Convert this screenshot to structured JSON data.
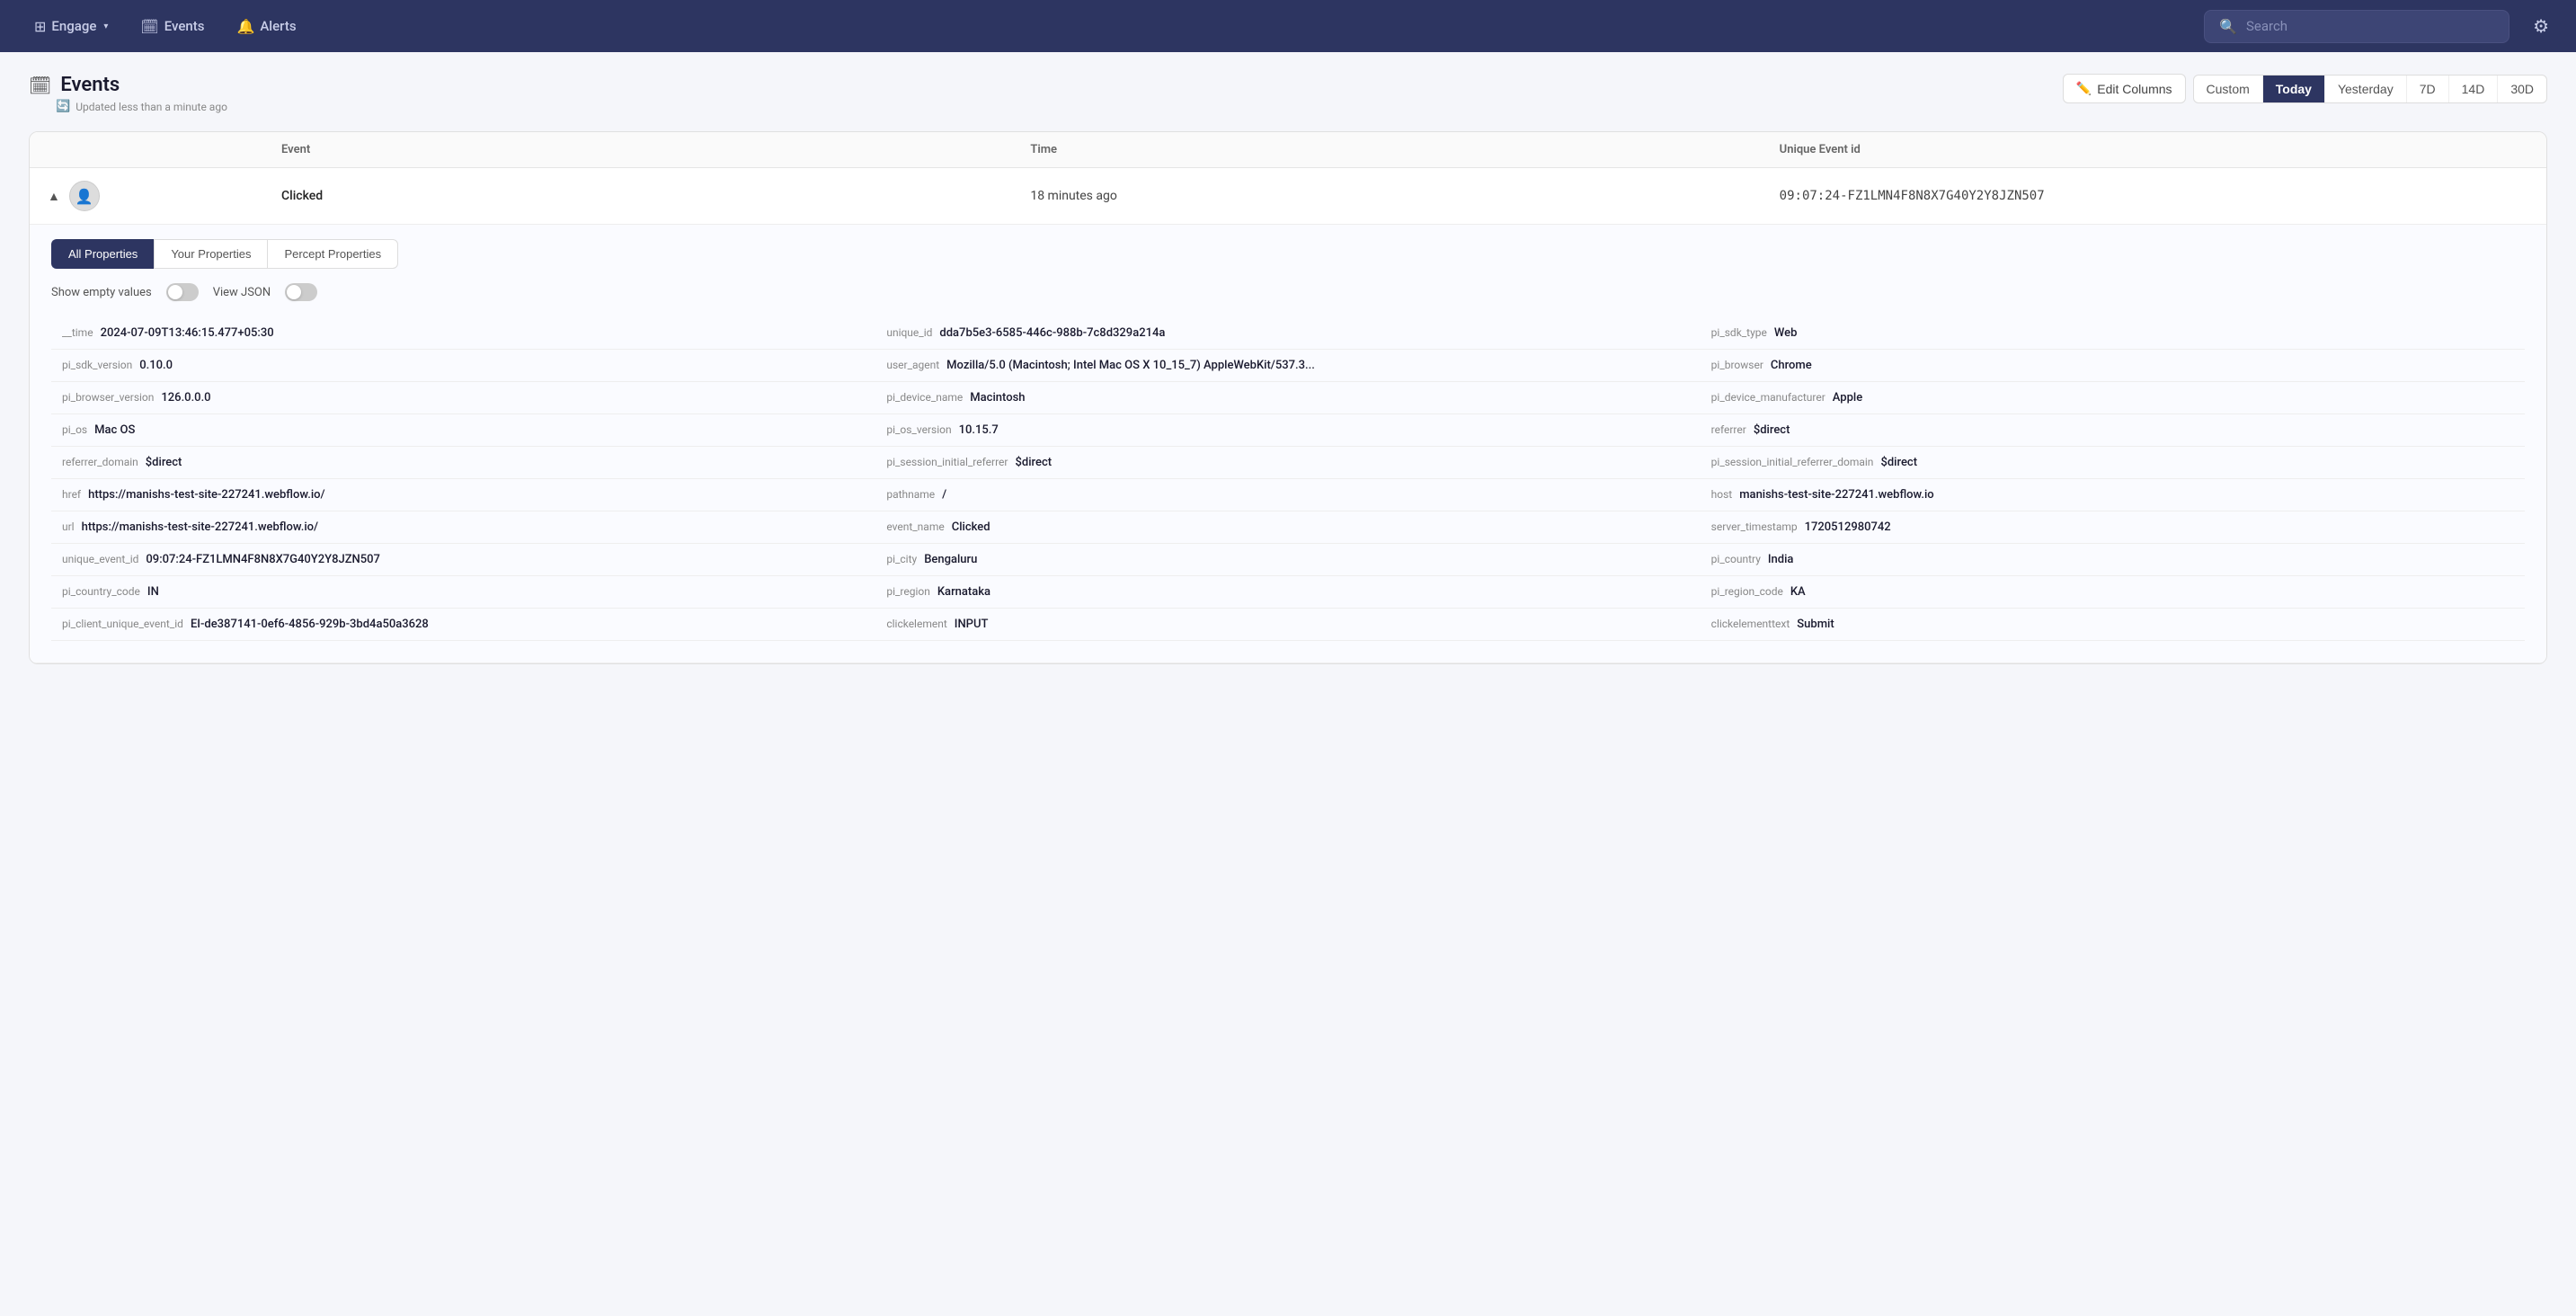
{
  "topnav": {
    "engage_label": "Engage",
    "events_label": "Events",
    "alerts_label": "Alerts",
    "search_placeholder": "Search"
  },
  "page": {
    "title": "Events",
    "title_icon": "📅",
    "updated_text": "Updated less than a minute ago",
    "edit_columns_label": "Edit Columns"
  },
  "time_filters": [
    {
      "label": "Custom",
      "key": "custom",
      "active": false
    },
    {
      "label": "Today",
      "key": "today",
      "active": true
    },
    {
      "label": "Yesterday",
      "key": "yesterday",
      "active": false
    },
    {
      "label": "7D",
      "key": "7d",
      "active": false
    },
    {
      "label": "14D",
      "key": "14d",
      "active": false
    },
    {
      "label": "30D",
      "key": "30d",
      "active": false
    }
  ],
  "table": {
    "columns": [
      "",
      "Event",
      "Time",
      "Unique Event id"
    ],
    "rows": [
      {
        "event": "Clicked",
        "time": "18 minutes ago",
        "unique_event_id": "09:07:24-FZ1LMN4F8N8X7G40Y2Y8JZN507",
        "expanded": true
      }
    ]
  },
  "property_tabs": [
    {
      "label": "All Properties",
      "active": true
    },
    {
      "label": "Your Properties",
      "active": false
    },
    {
      "label": "Percept Properties",
      "active": false
    }
  ],
  "toggles": {
    "show_empty_label": "Show empty values",
    "view_json_label": "View JSON"
  },
  "properties": [
    {
      "key": "__time",
      "value": "2024-07-09T13:46:15.477+05:30"
    },
    {
      "key": "unique_id",
      "value": "dda7b5e3-6585-446c-988b-7c8d329a214a"
    },
    {
      "key": "pi_sdk_type",
      "value": "Web"
    },
    {
      "key": "pi_sdk_version",
      "value": "0.10.0"
    },
    {
      "key": "user_agent",
      "value": "Mozilla/5.0 (Macintosh; Intel Mac OS X 10_15_7) AppleWebKit/537.3..."
    },
    {
      "key": "pi_browser",
      "value": "Chrome"
    },
    {
      "key": "pi_browser_version",
      "value": "126.0.0.0"
    },
    {
      "key": "pi_device_name",
      "value": "Macintosh"
    },
    {
      "key": "pi_device_manufacturer",
      "value": "Apple"
    },
    {
      "key": "pi_os",
      "value": "Mac OS"
    },
    {
      "key": "pi_os_version",
      "value": "10.15.7"
    },
    {
      "key": "referrer",
      "value": "$direct"
    },
    {
      "key": "referrer_domain",
      "value": "$direct"
    },
    {
      "key": "pi_session_initial_referrer",
      "value": "$direct"
    },
    {
      "key": "pi_session_initial_referrer_domain",
      "value": "$direct"
    },
    {
      "key": "href",
      "value": "https://manishs-test-site-227241.webflow.io/"
    },
    {
      "key": "pathname",
      "value": "/"
    },
    {
      "key": "host",
      "value": "manishs-test-site-227241.webflow.io"
    },
    {
      "key": "url",
      "value": "https://manishs-test-site-227241.webflow.io/"
    },
    {
      "key": "event_name",
      "value": "Clicked"
    },
    {
      "key": "server_timestamp",
      "value": "1720512980742"
    },
    {
      "key": "unique_event_id",
      "value": "09:07:24-FZ1LMN4F8N8X7G40Y2Y8JZN507"
    },
    {
      "key": "pi_city",
      "value": "Bengaluru"
    },
    {
      "key": "pi_country",
      "value": "India"
    },
    {
      "key": "pi_country_code",
      "value": "IN"
    },
    {
      "key": "pi_region",
      "value": "Karnataka"
    },
    {
      "key": "pi_region_code",
      "value": "KA"
    },
    {
      "key": "pi_client_unique_event_id",
      "value": "EI-de387141-0ef6-4856-929b-3bd4a50a3628"
    },
    {
      "key": "clickelement",
      "value": "INPUT"
    },
    {
      "key": "clickelementtext",
      "value": "Submit"
    }
  ]
}
